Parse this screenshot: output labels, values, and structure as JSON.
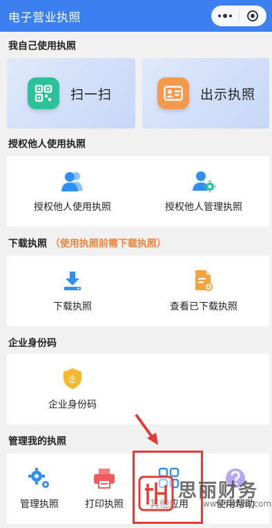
{
  "header": {
    "title": "电子营业执照"
  },
  "sections": {
    "self_use": "我自己使用执照",
    "authorize": "授权他人使用执照",
    "download": "下载执照",
    "download_note": "（使用执照前需下载执照）",
    "identity": "企业身份码",
    "manage": "管理我的执照"
  },
  "self_use": {
    "scan": "扫一扫",
    "show": "出示执照"
  },
  "authorize": {
    "use": "授权他人使用执照",
    "manage": "授权他人管理执照"
  },
  "download": {
    "download": "下载执照",
    "view": "查看已下载执照"
  },
  "identity": {
    "code": "企业身份码",
    "badge_char": "企"
  },
  "manage": {
    "manage": "管理执照",
    "print": "打印执照",
    "other": "其他应用",
    "help": "使用帮助"
  },
  "watermark": {
    "name": "思丽财务",
    "url": "www.tadgkj.com"
  },
  "colors": {
    "header": "#3b7ff0",
    "scan_icon": "#2bc29a",
    "show_icon": "#f39a4c",
    "blue_icon": "#2f8ff4",
    "orange_icon": "#f7a23c",
    "annotation": "#e53935"
  }
}
